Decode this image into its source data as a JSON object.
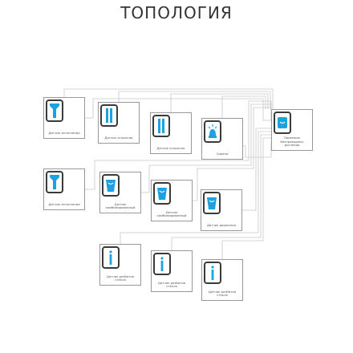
{
  "title": "ТОПОЛОГИЯ",
  "colors": {
    "accent": "#1aa3e0",
    "wire": "#c8c8c8",
    "frame": "#999999",
    "icon_outline": "#3a3a3a"
  },
  "devices": [
    {
      "id": "d1",
      "icon": "room-sensor-icon",
      "label": "Датчик затопления"
    },
    {
      "id": "d2",
      "icon": "door-sensor-icon",
      "label": "Датчик открытия"
    },
    {
      "id": "d3",
      "icon": "door-sensor-icon",
      "label": "Датчик открытия"
    },
    {
      "id": "d4",
      "icon": "siren-icon",
      "label": "Сирена"
    },
    {
      "id": "d5",
      "icon": "hub-icon",
      "label": "Приемник беспроводных датчиков"
    },
    {
      "id": "d6",
      "icon": "room-sensor-icon",
      "label": "Датчик затопления"
    },
    {
      "id": "d7",
      "icon": "motion-sensor-icon",
      "label": "Датчик комбинированный"
    },
    {
      "id": "d8",
      "icon": "motion-sensor-icon",
      "label": "Датчик комбинированный"
    },
    {
      "id": "d9",
      "icon": "motion-sensor-icon",
      "label": "Датчик движения"
    },
    {
      "id": "d10",
      "icon": "glass-sensor-icon",
      "label": "Датчик разбития стекла"
    },
    {
      "id": "d11",
      "icon": "glass-sensor-icon",
      "label": "Датчик разбития стекла"
    },
    {
      "id": "d12",
      "icon": "glass-sensor-icon",
      "label": "Датчик разбития стекла"
    }
  ]
}
